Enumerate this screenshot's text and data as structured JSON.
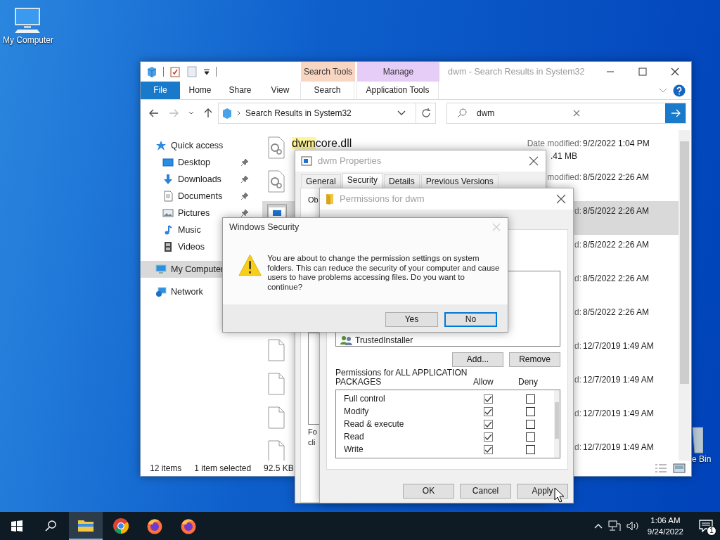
{
  "desktop_icons": [
    {
      "kind": "computer",
      "label": "My Computer"
    },
    {
      "kind": "recycle",
      "label": "e Bin"
    }
  ],
  "explorer": {
    "title": "dwm - Search Results in System32",
    "context_groups": [
      {
        "kind": "search",
        "label": "Search Tools",
        "tab": "Search"
      },
      {
        "kind": "manage",
        "label": "Manage",
        "tab": "Application Tools"
      }
    ],
    "tabs": [
      {
        "kind": "file",
        "label": "File"
      },
      {
        "kind": "plain",
        "label": "Home"
      },
      {
        "kind": "plain",
        "label": "Share"
      },
      {
        "kind": "plain",
        "label": "View"
      }
    ],
    "address": "Search Results in System32",
    "search": {
      "value": "dwm"
    },
    "nav": [
      {
        "label": "Quick access",
        "kind": "star",
        "selected": false,
        "children": [
          {
            "label": "Desktop",
            "kind": "desktop",
            "pinned": true,
            "selected": false
          },
          {
            "label": "Downloads",
            "kind": "download",
            "pinned": true,
            "selected": false
          },
          {
            "label": "Documents",
            "kind": "documents",
            "pinned": true,
            "selected": false
          },
          {
            "label": "Pictures",
            "kind": "pictures",
            "pinned": true,
            "selected": false
          },
          {
            "label": "Music",
            "kind": "music",
            "pinned": false,
            "selected": false
          },
          {
            "label": "Videos",
            "kind": "videos",
            "pinned": false,
            "selected": false
          }
        ]
      },
      {
        "label": "My Computer",
        "kind": "computer",
        "selected": true
      },
      {
        "label": "Network",
        "kind": "network",
        "selected": false
      }
    ],
    "files": [
      {
        "kind": "gear",
        "name_match": "dwm",
        "name_rest": "core.dll",
        "date_label": "Date modified:",
        "date": "9/2/2022 1:04 PM",
        "size": ".41 MB",
        "selected": false
      },
      {
        "kind": "gear",
        "date_label": "modified:",
        "date": "8/5/2022 2:26 AM",
        "selected": false
      },
      {
        "kind": "app",
        "date_label": "d:",
        "date": "8/5/2022 2:26 AM",
        "selected": true
      },
      {
        "date_label": "d:",
        "date": "8/5/2022 2:26 AM",
        "selected": false
      },
      {
        "date_label": "d:",
        "date": "8/5/2022 2:26 AM",
        "selected": false
      },
      {
        "date_label": "d:",
        "date": "8/5/2022 2:26 AM",
        "selected": false
      },
      {
        "kind": "blank",
        "date_label": "d:",
        "date": "12/7/2019 1:49 AM",
        "selected": false
      },
      {
        "kind": "blank",
        "date_label": "d:",
        "date": "12/7/2019 1:49 AM",
        "selected": false
      },
      {
        "kind": "blank",
        "date_label": "d:",
        "date": "12/7/2019 1:49 AM",
        "selected": false
      },
      {
        "kind": "blank",
        "date_label": "d:",
        "date": "12/7/2019 1:49 AM",
        "selected": false
      }
    ],
    "status": {
      "count": "12 items",
      "selection": "1 item selected",
      "size": "92.5 KB"
    }
  },
  "properties": {
    "title": "dwm Properties",
    "tabs": [
      {
        "label": "General",
        "selected": false
      },
      {
        "label": "Security",
        "selected": true
      },
      {
        "label": "Details",
        "selected": false
      },
      {
        "label": "Previous Versions",
        "selected": false
      }
    ],
    "fragments": [
      "Ob",
      "Fo",
      "cli"
    ]
  },
  "permissions": {
    "title": "Permissions for dwm",
    "groups": [
      {
        "label": "TrustedInstaller"
      }
    ],
    "group_buttons": [
      "Add...",
      "Remove"
    ],
    "perm_title": "Permissions for ALL APPLICATION PACKAGES",
    "allow_label": "Allow",
    "deny_label": "Deny",
    "perms": [
      {
        "label": "Full control",
        "allow": true,
        "deny": false
      },
      {
        "label": "Modify",
        "allow": true,
        "deny": false
      },
      {
        "label": "Read & execute",
        "allow": true,
        "deny": false
      },
      {
        "label": "Read",
        "allow": true,
        "deny": false
      },
      {
        "label": "Write",
        "allow": true,
        "deny": false
      }
    ],
    "buttons": [
      "OK",
      "Cancel",
      "Apply"
    ]
  },
  "security_dialog": {
    "title": "Windows Security",
    "message": "You are about to change the permission settings on system folders. This can reduce the security of your computer and cause users to have problems accessing files. Do you want to continue?",
    "buttons": [
      {
        "label": "Yes",
        "focused": false
      },
      {
        "label": "No",
        "focused": true
      }
    ]
  },
  "taskbar": {
    "apps": [
      {
        "kind": "explorer",
        "active": true
      },
      {
        "kind": "chrome",
        "active": false
      },
      {
        "kind": "firefox",
        "active": false
      },
      {
        "kind": "firefox",
        "active": false
      }
    ],
    "time": "1:06 AM",
    "date": "9/24/2022",
    "notifications": "1"
  }
}
